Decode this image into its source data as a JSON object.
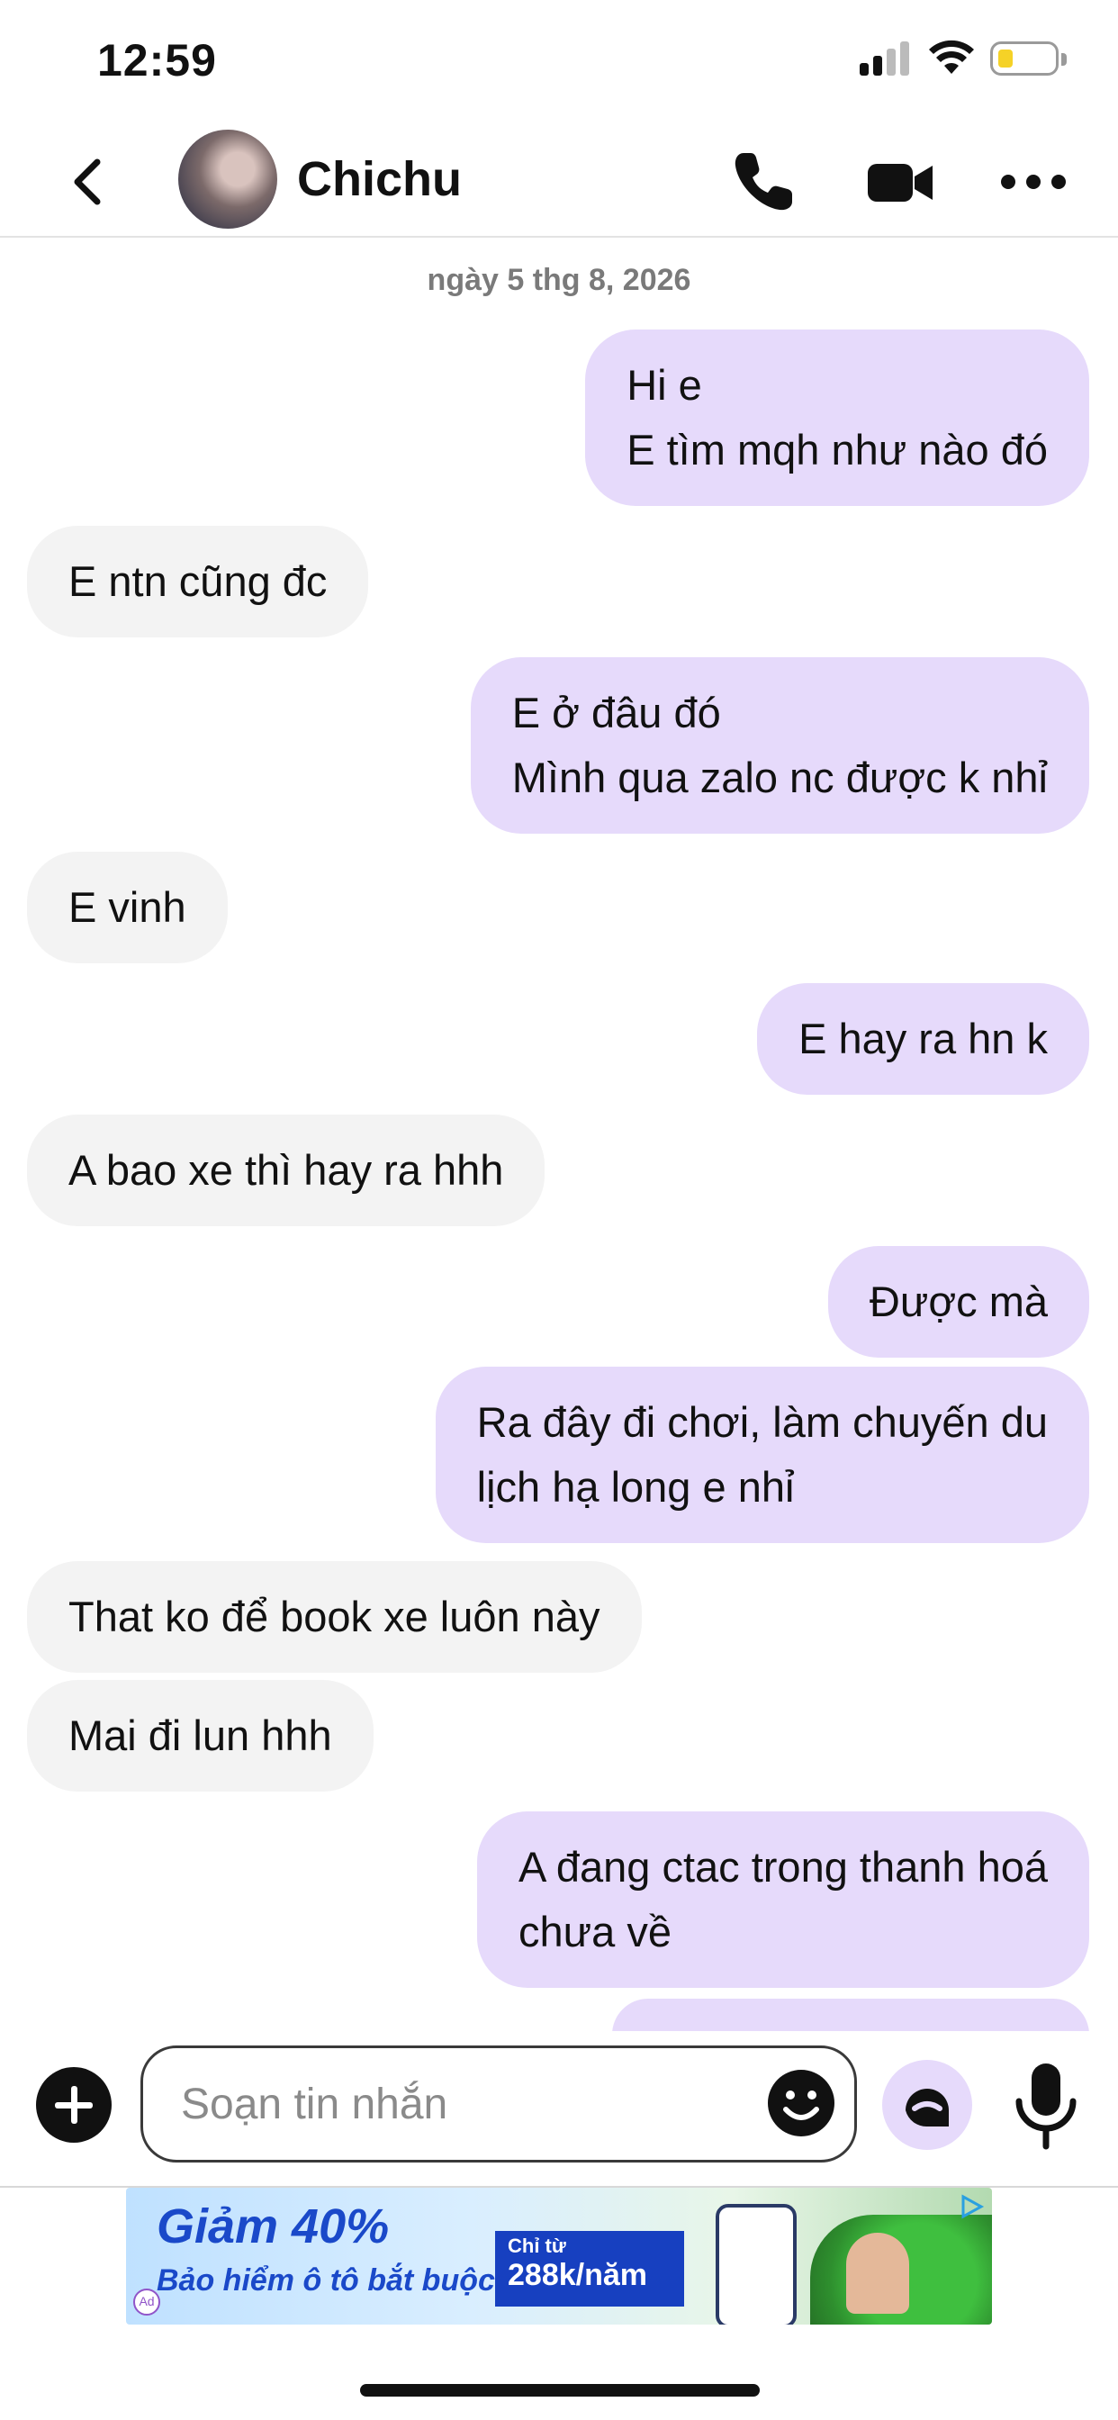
{
  "status_bar": {
    "time": "12:59"
  },
  "header": {
    "contact_name": "Chichu"
  },
  "chat": {
    "date_separator": "ngày 5 thg 8, 2026",
    "messages": [
      {
        "from": "me",
        "lines": [
          "Hi e",
          "E tìm mqh như nào đó"
        ]
      },
      {
        "from": "them",
        "lines": [
          "E ntn cũng đc"
        ]
      },
      {
        "from": "me",
        "lines": [
          "E ở đâu đó",
          "Mình qua zalo nc được k nhỉ"
        ]
      },
      {
        "from": "them",
        "lines": [
          "E vinh"
        ]
      },
      {
        "from": "me",
        "lines": [
          "E hay ra hn k"
        ]
      },
      {
        "from": "them",
        "lines": [
          "A bao xe thì hay ra hhh"
        ]
      },
      {
        "from": "me",
        "lines": [
          "Được mà"
        ]
      },
      {
        "from": "me",
        "lines": [
          "Ra đây đi chơi, làm chuyến du",
          "lịch hạ long e nhỉ"
        ]
      },
      {
        "from": "them",
        "lines": [
          "That ko để book xe luôn này"
        ]
      },
      {
        "from": "them",
        "lines": [
          "Mai đi lun hhh"
        ]
      },
      {
        "from": "me",
        "lines": [
          "A đang ctac trong thanh hoá",
          "chưa về"
        ]
      }
    ]
  },
  "composer": {
    "placeholder": "Soạn tin nhắn"
  },
  "ad": {
    "headline": "Giảm 40%",
    "subline": "Bảo hiểm ô tô bắt buộc",
    "price_prefix": "Chỉ từ",
    "price": "288k/năm",
    "ad_label": "Ad"
  }
}
